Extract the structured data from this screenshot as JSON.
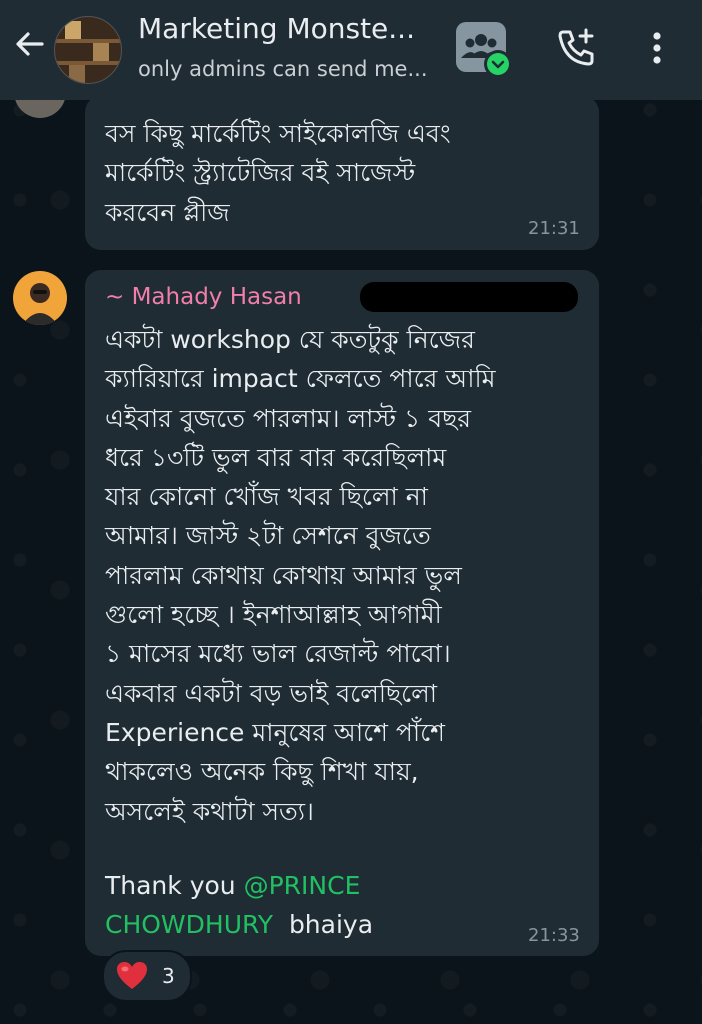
{
  "header": {
    "title": "Marketing Monste...",
    "subtitle": "only admins can send me..."
  },
  "messages": [
    {
      "text": "বস কিছু মার্কেটিং সাইকোলজি এবং\nমার্কেটিং স্ট্র্যাটেজির বই সাজেস্ট\nকরবেন প্লীজ",
      "time": "21:31"
    },
    {
      "sender": "~ Mahady Hasan",
      "text": "একটা workshop যে কতটুকু নিজের\nক্যারিয়ারে impact ফেলতে পারে আমি\nএইবার বুজতে পারলাম। লাস্ট ১ বছর\nধরে ১৩টি ভুল বার বার করেছিলাম\nযার কোনো খোঁজ খবর ছিলো না\nআমার। জাস্ট ২টা সেশনে বুজতে\nপারলাম কোথায় কোথায় আমার ভুল\nগুলো হচ্ছে । ইনশাআল্লাহ আগামী\n১ মাসের মধ্যে ভাল রেজাল্ট পাবো।\nএকবার একটা বড় ভাই বলেছিলো\nExperience মানুষের আশে পাঁশে\nথাকলেও অনেক কিছু শিখা যায়,\nঅসলেই কথাটা সত্য।",
      "thanks_prefix": "Thank you ",
      "mention_line1": "@PRINCE",
      "mention_line2": "CHOWDHURY",
      "thanks_suffix": "  bhaiya",
      "time": "21:33",
      "reaction": {
        "emoji": "heart-icon",
        "count": "3"
      }
    }
  ],
  "colors": {
    "header_bg": "#1f2c34",
    "bubble_bg": "#1f2c34",
    "sender_name": "#f27eaa",
    "mention": "#21c063",
    "badge": "#25d366"
  }
}
